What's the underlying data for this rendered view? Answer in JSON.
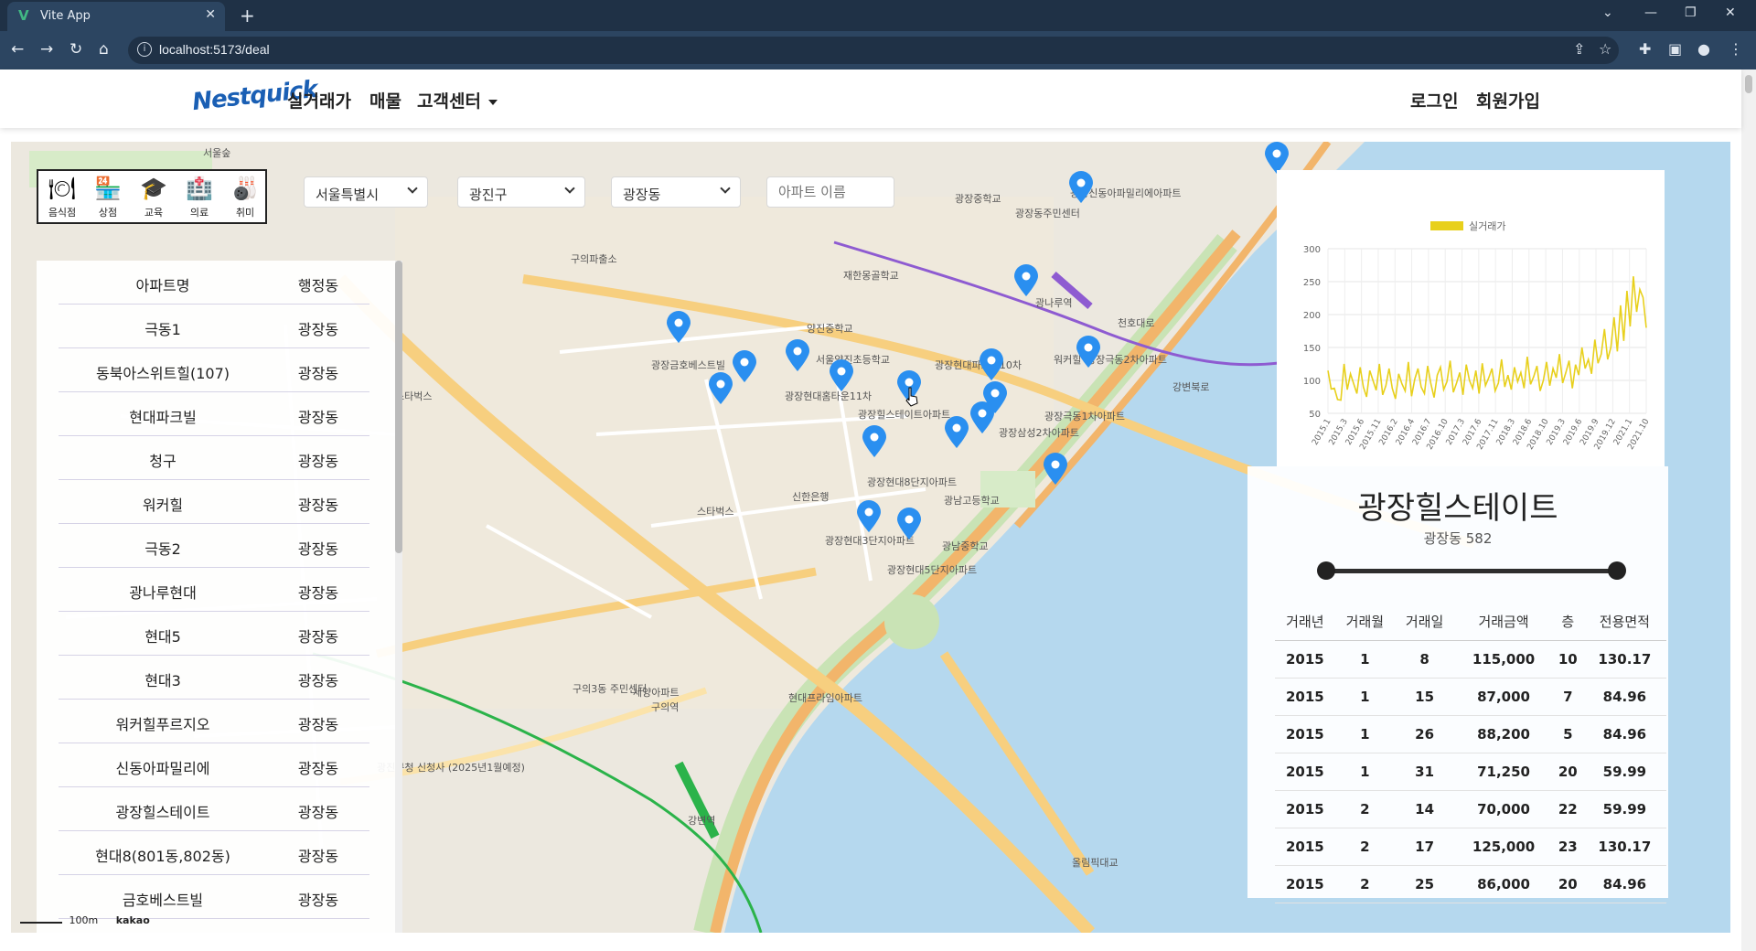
{
  "browser": {
    "tab_title": "Vite App",
    "tab_favicon": "V",
    "url": "localhost:5173/deal"
  },
  "header": {
    "logo_text": "Nestquick",
    "nav": [
      "실거래가",
      "매물",
      "고객센터"
    ],
    "login": "로그인",
    "signup": "회원가입"
  },
  "categories": [
    {
      "icon": "restaurant-icon",
      "glyph": "🍽",
      "label": "음식점"
    },
    {
      "icon": "store-icon",
      "glyph": "🏪",
      "label": "상점"
    },
    {
      "icon": "school-icon",
      "glyph": "🎓",
      "label": "교육"
    },
    {
      "icon": "hospital-icon",
      "glyph": "🏥",
      "label": "의료"
    },
    {
      "icon": "hobby-icon",
      "glyph": "🎳",
      "label": "취미"
    }
  ],
  "filters": {
    "city": "서울특별시",
    "district": "광진구",
    "dong": "광장동",
    "apt_placeholder": "아파트 이름"
  },
  "apt_list": {
    "headers": [
      "아파트명",
      "행정동"
    ],
    "rows": [
      {
        "name": "극동1",
        "dong": "광장동"
      },
      {
        "name": "동북아스위트힐(107)",
        "dong": "광장동"
      },
      {
        "name": "현대파크빌",
        "dong": "광장동"
      },
      {
        "name": "청구",
        "dong": "광장동"
      },
      {
        "name": "워커힐",
        "dong": "광장동"
      },
      {
        "name": "극동2",
        "dong": "광장동"
      },
      {
        "name": "광나루현대",
        "dong": "광장동"
      },
      {
        "name": "현대5",
        "dong": "광장동"
      },
      {
        "name": "현대3",
        "dong": "광장동"
      },
      {
        "name": "워커힐푸르지오",
        "dong": "광장동"
      },
      {
        "name": "신동아파밀리에",
        "dong": "광장동"
      },
      {
        "name": "광장힐스테이트",
        "dong": "광장동"
      },
      {
        "name": "현대8(801동,802동)",
        "dong": "광장동"
      },
      {
        "name": "금호베스트빌",
        "dong": "광장동"
      }
    ]
  },
  "chart_data": {
    "type": "line",
    "legend": [
      "실거래가"
    ],
    "legend_position": "top",
    "series_color": "#e8d01c",
    "ylim": [
      50,
      300
    ],
    "yticks": [
      50,
      100,
      150,
      200,
      250,
      300
    ],
    "xticks": [
      "2015.1",
      "2015.3",
      "2015.6",
      "2015.11",
      "2016.2",
      "2016.4",
      "2016.7",
      "2016.10",
      "2017.3",
      "2017.6",
      "2017.11",
      "2018.3",
      "2018.6",
      "2018.10",
      "2019.3",
      "2019.6",
      "2019.9",
      "2019.12",
      "2021.1",
      "2021.10"
    ],
    "grid": true,
    "series": [
      {
        "name": "실거래가",
        "values": [
          115,
          87,
          88,
          71,
          70,
          125,
          86,
          110,
          95,
          80,
          120,
          90,
          75,
          115,
          100,
          85,
          125,
          78,
          92,
          118,
          88,
          72,
          110,
          95,
          84,
          128,
          76,
          102,
          118,
          90,
          80,
          122,
          95,
          74,
          108,
          120,
          86,
          98,
          130,
          82,
          96,
          112,
          78,
          124,
          100,
          88,
          115,
          80,
          126,
          92,
          104,
          118,
          84,
          96,
          132,
          90,
          108,
          86,
          120,
          98,
          112,
          88,
          136,
          94,
          106,
          122,
          84,
          100,
          128,
          92,
          118,
          104,
          140,
          96,
          112,
          130,
          88,
          124,
          108,
          150,
          118,
          132,
          110,
          162,
          126,
          140,
          178,
          132,
          150,
          196,
          144,
          214,
          160,
          236,
          182,
          258,
          204,
          238,
          226,
          180
        ]
      }
    ]
  },
  "detail": {
    "apt_name": "광장힐스테이트",
    "address": "광장동 582",
    "slider_range": [
      0,
      1
    ],
    "table_headers": [
      "거래년",
      "거래월",
      "거래일",
      "거래금액",
      "층",
      "전용면적"
    ],
    "rows": [
      [
        "2015",
        "1",
        "8",
        "115,000",
        "10",
        "130.17"
      ],
      [
        "2015",
        "1",
        "15",
        "87,000",
        "7",
        "84.96"
      ],
      [
        "2015",
        "1",
        "26",
        "88,200",
        "5",
        "84.96"
      ],
      [
        "2015",
        "1",
        "31",
        "71,250",
        "20",
        "59.99"
      ],
      [
        "2015",
        "2",
        "14",
        "70,000",
        "22",
        "59.99"
      ],
      [
        "2015",
        "2",
        "17",
        "125,000",
        "23",
        "130.17"
      ],
      [
        "2015",
        "2",
        "25",
        "86,000",
        "20",
        "84.96"
      ]
    ]
  },
  "map": {
    "labels": [
      "서울숲",
      "구의파출소",
      "광장중학교",
      "광장동주민센터",
      "광장신동아파밀리에아파트",
      "재한몽골학교",
      "양진중학교",
      "서울양진초등학교",
      "광장금호베스트빌",
      "광장현대홈타운11차",
      "광장힐스테이트아파트",
      "광장현대파크빌10차",
      "광장극동1차아파트",
      "광장극동2차아파트",
      "광장삼성2차아파트",
      "광장현대8단지아파트",
      "광장현대3단지아파트",
      "광장현대5단지아파트",
      "광남고등학교",
      "광남중학교",
      "신한은행",
      "스타벅스",
      "광진구청 신청사 (2025년1월예정)",
      "구의3동 주민센터",
      "세양아파트",
      "현대프라임아파트",
      "강변역",
      "구의역",
      "스타벅스",
      "천호대로",
      "강변북로",
      "올림픽대교",
      "워커힐",
      "광나루역",
      "kakao",
      "100m"
    ],
    "scale": "100m",
    "provider": "kakao"
  },
  "colors": {
    "pin": "#2a8ff0",
    "water": "#b5d8ee",
    "road_major": "#f2b56b",
    "park": "#c9e3b5"
  }
}
